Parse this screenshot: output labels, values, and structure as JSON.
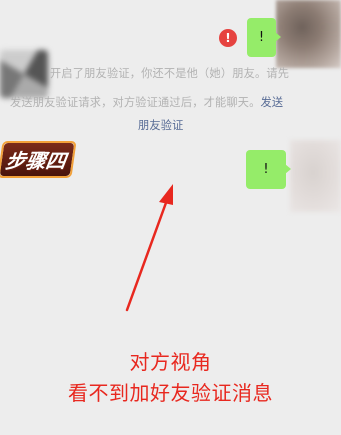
{
  "top_message": {
    "bubble_text": "!",
    "fail_icon": "exclamation-icon",
    "fail_color": "#e64340"
  },
  "system_notice": {
    "line1": "开启了朋友验证，你还不是他（她）朋友。请先",
    "line2_text": "发送朋友验证请求，对方验证通过后，才能聊天。",
    "line2_link": "发送",
    "line3_link": "朋友验证",
    "text_color": "#b2b2b2",
    "link_color": "#576b95"
  },
  "step_label": "步骤四",
  "bottom_message": {
    "bubble_text": "!"
  },
  "annotation": {
    "line1": "对方视角",
    "line2": "看不到加好友验证消息",
    "color": "#e8281f"
  },
  "colors": {
    "background": "#ededed",
    "bubble": "#95ec69"
  }
}
